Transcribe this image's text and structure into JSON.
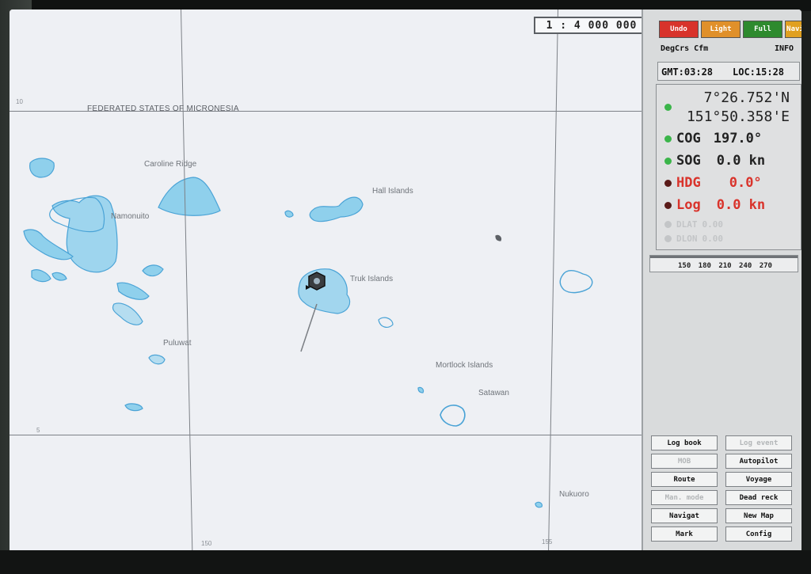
{
  "map": {
    "scale": "1 : 4 000 000",
    "region_title": "FEDERATED STATES OF MICRONESIA",
    "place_labels": {
      "caroline_ridge": "Caroline Ridge",
      "hall_islands": "Hall Islands",
      "namonuito": "Namonuito",
      "truk_islands": "Truk Islands",
      "puluwat": "Puluwat",
      "mortlock_islands": "Mortlock Islands",
      "satawan": "Satawan",
      "nukuoro": "Nukuoro"
    },
    "grid_ticks": {
      "lat_top": "10",
      "lat_bottom": "5",
      "lon_left": "150",
      "lon_right": "155"
    },
    "colors": {
      "land": "#8fd0ec",
      "land_outline": "#4aa3d6",
      "sea": "#eef0f4",
      "grid": "#7d8187"
    },
    "own_ship": {
      "icon": "own-ship-icon",
      "heading_deg": 197.0
    }
  },
  "panel": {
    "mode_buttons": [
      {
        "label": "Undo",
        "color": "#d8332b"
      },
      {
        "label": "Light",
        "color": "#e0902a"
      },
      {
        "label": "Full",
        "color": "#2e8a2e"
      },
      {
        "label": "Navi",
        "color": "#e0a020"
      }
    ],
    "status_line": {
      "left": "DegCrs Cfm",
      "right": "INFO"
    },
    "time": {
      "gmt": "GMT:03:28",
      "loc": "LOC:15:28"
    },
    "position": {
      "lat": "7°26.752'N",
      "lon": "151°50.358'E"
    },
    "nav": [
      {
        "label": "COG",
        "value": "197.0°",
        "status": "ok"
      },
      {
        "label": "SOG",
        "value": "0.0 kn",
        "status": "ok"
      },
      {
        "label": "HDG",
        "value": "0.0°",
        "status": "alarm"
      },
      {
        "label": "Log",
        "value": "0.0 kn",
        "status": "alarm"
      },
      {
        "label": "DLAT",
        "value": "0.00",
        "status": "off"
      },
      {
        "label": "DLON",
        "value": "0.00",
        "status": "off"
      }
    ],
    "bearing_scale": "150 180 210 240 270",
    "buttons": [
      {
        "label": "Log book",
        "enabled": true
      },
      {
        "label": "Log event",
        "enabled": false
      },
      {
        "label": "MOB",
        "enabled": false
      },
      {
        "label": "Autopilot",
        "enabled": true
      },
      {
        "label": "Route",
        "enabled": true
      },
      {
        "label": "Voyage",
        "enabled": true
      },
      {
        "label": "Man. mode",
        "enabled": false
      },
      {
        "label": "Dead reck",
        "enabled": true
      },
      {
        "label": "Navigat",
        "enabled": true
      },
      {
        "label": "New Map",
        "enabled": true
      },
      {
        "label": "Mark",
        "enabled": true
      },
      {
        "label": "Config",
        "enabled": true
      }
    ]
  }
}
